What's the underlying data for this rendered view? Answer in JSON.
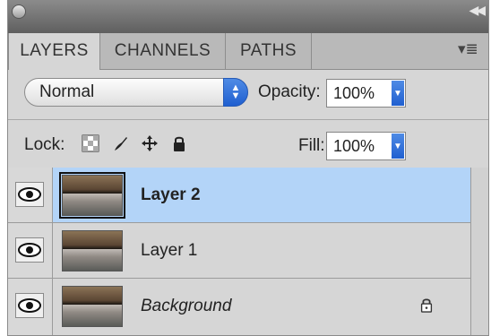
{
  "tabs": [
    {
      "label": "LAYERS",
      "active": true
    },
    {
      "label": "CHANNELS",
      "active": false
    },
    {
      "label": "PATHS",
      "active": false
    }
  ],
  "blend": {
    "value": "Normal"
  },
  "opacity": {
    "label": "Opacity:",
    "value": "100%"
  },
  "lock": {
    "label": "Lock:",
    "icons": [
      "transparency-lock-icon",
      "brush-lock-icon",
      "move-lock-icon",
      "lock-icon"
    ]
  },
  "fill": {
    "label": "Fill:",
    "value": "100%"
  },
  "layers": [
    {
      "name": "Layer 2",
      "selected": true,
      "visible": true
    },
    {
      "name": "Layer 1",
      "selected": false,
      "visible": true
    },
    {
      "name": "Background",
      "selected": false,
      "visible": true,
      "locked": true
    }
  ],
  "colors": {
    "selection": "#b3d4f8",
    "accent": "#2f72dd"
  }
}
